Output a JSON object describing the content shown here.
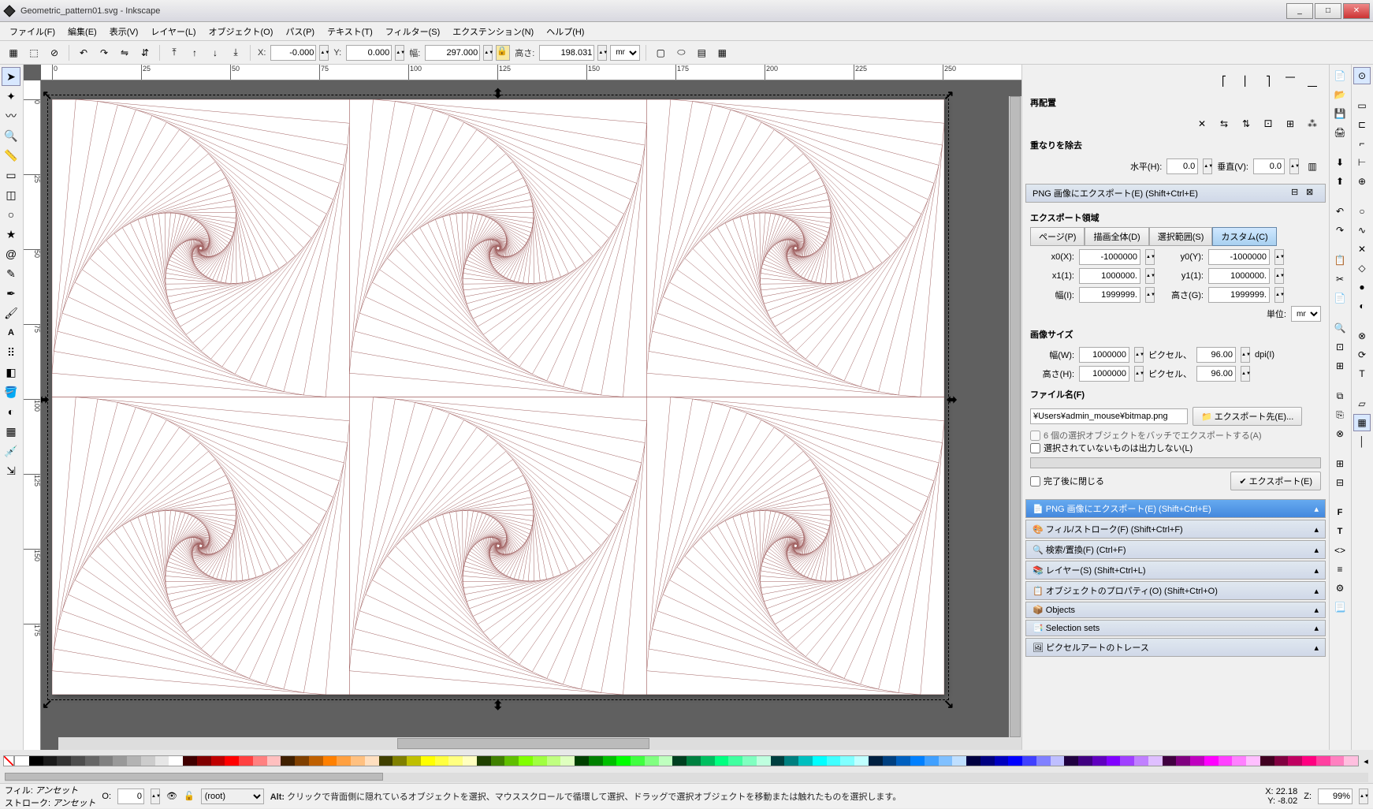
{
  "window": {
    "title": "Geometric_pattern01.svg - Inkscape",
    "btn_min": "_",
    "btn_max": "□",
    "btn_close": "✕"
  },
  "menu": {
    "file": "ファイル(F)",
    "edit": "編集(E)",
    "view": "表示(V)",
    "layer": "レイヤー(L)",
    "object": "オブジェクト(O)",
    "path": "パス(P)",
    "text": "テキスト(T)",
    "filters": "フィルター(S)",
    "extensions": "エクステンション(N)",
    "help": "ヘルプ(H)"
  },
  "optbar": {
    "x_label": "X:",
    "x_value": "-0.000",
    "y_label": "Y:",
    "y_value": "0.000",
    "w_label": "幅:",
    "w_value": "297.000",
    "h_label": "高さ:",
    "h_value": "198.031",
    "unit": "mm"
  },
  "ruler_ticks_top": [
    "0",
    "25",
    "50",
    "75",
    "100",
    "125",
    "150",
    "175",
    "200",
    "225",
    "250"
  ],
  "ruler_ticks_left": [
    "0",
    "25",
    "50",
    "75",
    "100",
    "125",
    "150",
    "175"
  ],
  "panel": {
    "align_icons_title": "",
    "rearrange_title": "再配置",
    "remove_overlap_title": "重なりを除去",
    "horiz_label": "水平(H):",
    "horiz_value": "0.0",
    "vert_label": "垂直(V):",
    "vert_value": "0.0",
    "export_png_title": "PNG 画像にエクスポート(E) (Shift+Ctrl+E)",
    "export_area_title": "エクスポート領域",
    "tab_page": "ページ(P)",
    "tab_drawing": "描画全体(D)",
    "tab_selection": "選択範囲(S)",
    "tab_custom": "カスタム(C)",
    "x0_label": "x0(X):",
    "x0_value": "-1000000",
    "y0_label": "y0(Y):",
    "y0_value": "-1000000",
    "x1_label": "x1(1):",
    "x1_value": "1000000.",
    "y1_label": "y1(1):",
    "y1_value": "1000000.",
    "width_label": "幅(I):",
    "width_value": "1999999.",
    "height_label": "高さ(G):",
    "height_value": "1999999.",
    "unit_label": "単位:",
    "unit_value": "mm",
    "imagesize_title": "画像サイズ",
    "img_w_label": "幅(W):",
    "img_w_value": "1000000",
    "pixels_label": "ピクセル、",
    "dpi_value": "96.00",
    "dpi_label": "dpi(I)",
    "img_h_label": "高さ(H):",
    "img_h_value": "1000000",
    "filename_title": "ファイル名(F)",
    "filename_value": "¥Users¥admin_mouse¥bitmap.png",
    "export_to_btn": "エクスポート先(E)...",
    "batch_checkbox": "6 個の選択オブジェクトをバッチでエクスポートする(A)",
    "hide_unselected": "選択されていないものは出力しない(L)",
    "close_after": "完了後に閉じる",
    "export_btn": "エクスポート(E)",
    "pt_export": "PNG 画像にエクスポート(E) (Shift+Ctrl+E)",
    "pt_fill": "フィル/ストローク(F) (Shift+Ctrl+F)",
    "pt_find": "検索/置換(F) (Ctrl+F)",
    "pt_layers": "レイヤー(S) (Shift+Ctrl+L)",
    "pt_objprop": "オブジェクトのプロパティ(O) (Shift+Ctrl+O)",
    "pt_objects": "Objects",
    "pt_selsets": "Selection sets",
    "pt_pixelart": "ピクセルアートのトレース"
  },
  "status": {
    "fill_label": "フィル:",
    "stroke_label": "ストローク:",
    "fill_value": "アンセット",
    "stroke_value": "アンセット",
    "opacity_label": "O:",
    "opacity_value": "0",
    "layer_value": "(root)",
    "hint_prefix": "Alt:",
    "hint_text": " クリックで背面側に隠れているオブジェクトを選択、マウススクロールで循環して選択、ドラッグで選択オブジェクトを移動または触れたものを選択します。",
    "x_label": "X:",
    "x_value": "22.18",
    "y_label": "Y:",
    "y_value": "-8.02",
    "z_label": "Z:",
    "z_value": "99%"
  },
  "palette_colors": [
    "#ffffff",
    "#000000",
    "#1a1a1a",
    "#333333",
    "#4d4d4d",
    "#666666",
    "#808080",
    "#999999",
    "#b3b3b3",
    "#cccccc",
    "#e6e6e6",
    "#ffffff",
    "#400000",
    "#800000",
    "#bf0000",
    "#ff0000",
    "#ff4040",
    "#ff8080",
    "#ffbfbf",
    "#402000",
    "#804000",
    "#bf6000",
    "#ff8000",
    "#ffa040",
    "#ffc080",
    "#ffdfbf",
    "#404000",
    "#808000",
    "#bfbf00",
    "#ffff00",
    "#ffff40",
    "#ffff80",
    "#ffffbf",
    "#204000",
    "#408000",
    "#60bf00",
    "#80ff00",
    "#a0ff40",
    "#c0ff80",
    "#dfffbf",
    "#004000",
    "#008000",
    "#00bf00",
    "#00ff00",
    "#40ff40",
    "#80ff80",
    "#bfffbf",
    "#004020",
    "#008040",
    "#00bf60",
    "#00ff80",
    "#40ffa0",
    "#80ffc0",
    "#bfffdf",
    "#004040",
    "#008080",
    "#00bfbf",
    "#00ffff",
    "#40ffff",
    "#80ffff",
    "#bfffff",
    "#002040",
    "#004080",
    "#0060bf",
    "#0080ff",
    "#40a0ff",
    "#80c0ff",
    "#bfdfff",
    "#000040",
    "#000080",
    "#0000bf",
    "#0000ff",
    "#4040ff",
    "#8080ff",
    "#bfbfff",
    "#200040",
    "#400080",
    "#6000bf",
    "#8000ff",
    "#a040ff",
    "#c080ff",
    "#dfbfff",
    "#400040",
    "#800080",
    "#bf00bf",
    "#ff00ff",
    "#ff40ff",
    "#ff80ff",
    "#ffbfff",
    "#400020",
    "#800040",
    "#bf0060",
    "#ff0080",
    "#ff40a0",
    "#ff80c0",
    "#ffbfdf"
  ]
}
